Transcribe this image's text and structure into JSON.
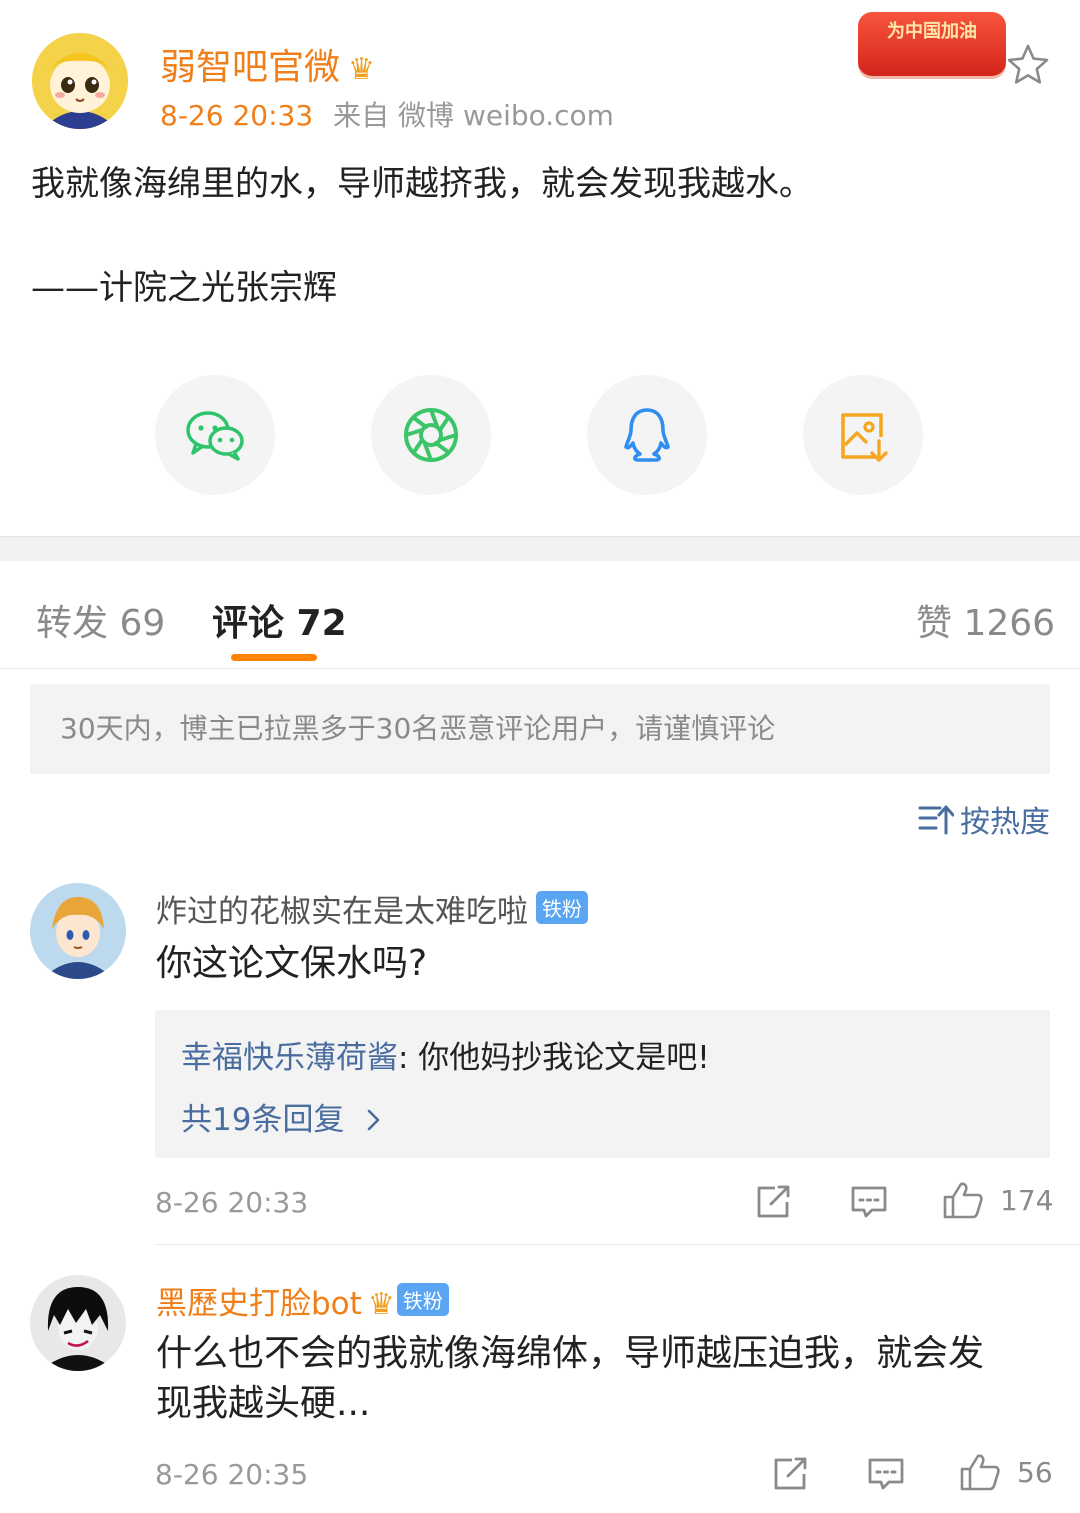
{
  "post": {
    "author_name": "弱智吧官微",
    "author_badge_icon": "crown-vip-icon",
    "time": "8-26 20:33",
    "source": "来自 微博 weibo.com",
    "cheer_badge": "为中国加油",
    "body": "我就像海绵里的水，导师越挤我，就会发现我越水。",
    "signature": "——计院之光张宗辉"
  },
  "share": [
    {
      "name": "wechat",
      "icon": "wechat-icon",
      "color": "#2ec46a"
    },
    {
      "name": "moments",
      "icon": "moments-icon",
      "color": "#3cc469"
    },
    {
      "name": "qq",
      "icon": "qq-icon",
      "color": "#2f8ef0"
    },
    {
      "name": "save-image",
      "icon": "save-image-icon",
      "color": "#f5a623"
    }
  ],
  "tabs": {
    "repost": "转发 69",
    "comments": "评论 72",
    "likes": "赞 1266",
    "active": "comments",
    "accent": "#ff8200"
  },
  "notice": "30天内，博主已拉黑多于30名恶意评论用户，请谨慎评论",
  "sort_label": "按热度",
  "comments": [
    {
      "user": "炸过的花椒实在是太难吃啦",
      "fan_tag": "铁粉",
      "text": "你这论文保水吗?",
      "reply_user": "幸福快乐薄荷酱",
      "reply_text": ": 你他妈抄我论文是吧!",
      "reply_more": "共19条回复",
      "time": "8-26 20:33",
      "likes": "174"
    },
    {
      "user": "黑歷史打脸bot",
      "fan_tag": "铁粉",
      "text_line1": "什么也不会的我就像海绵体，导师越压迫我，就会发",
      "text_line2": "现我越头硬...",
      "time": "8-26 20:35",
      "likes": "56"
    }
  ]
}
